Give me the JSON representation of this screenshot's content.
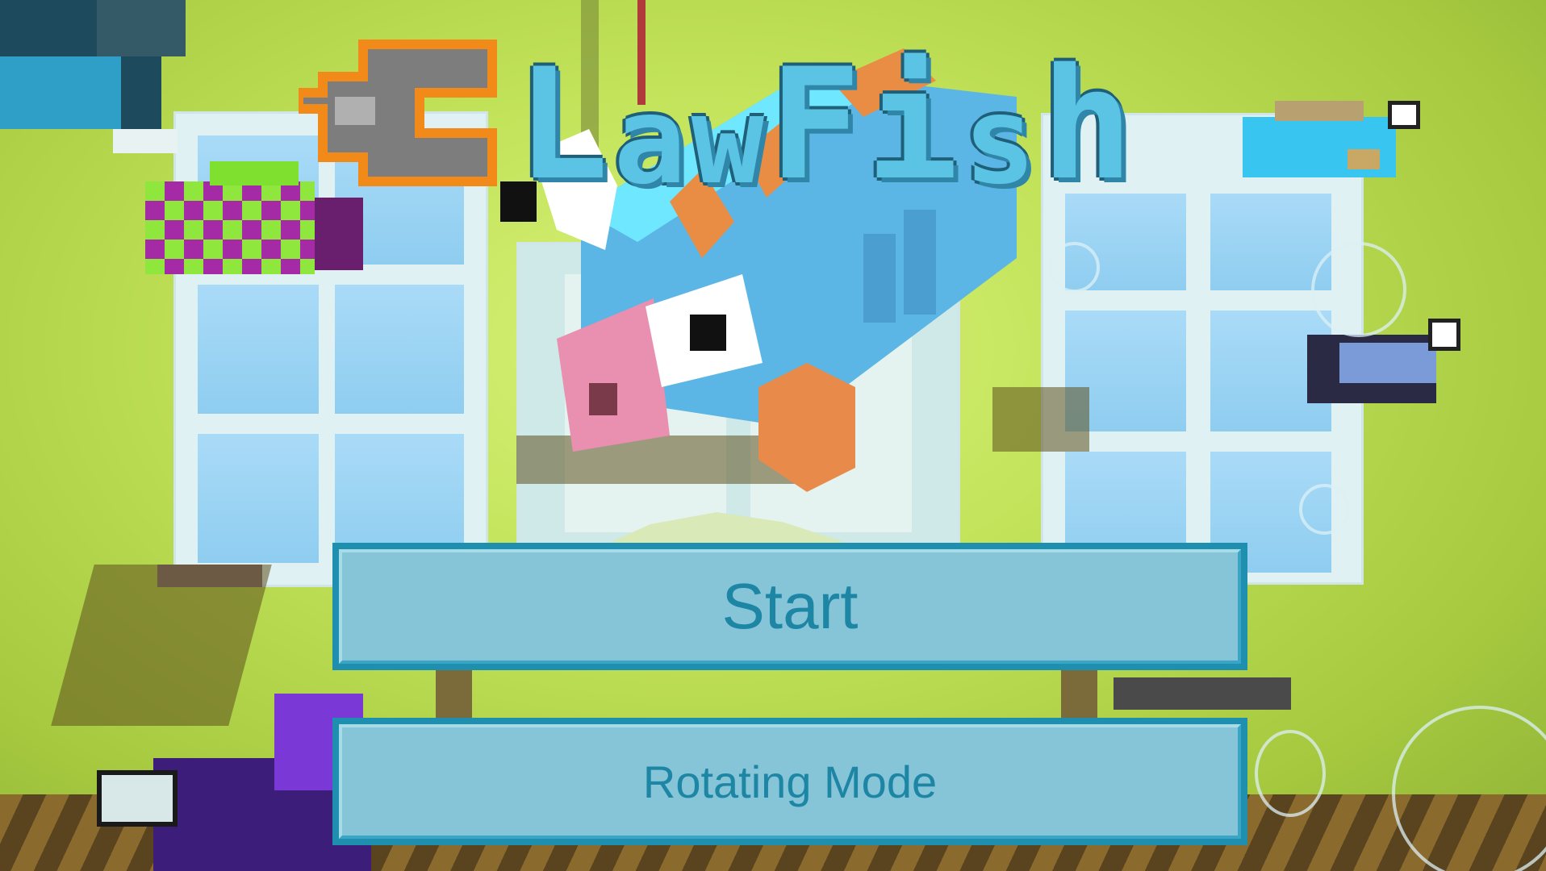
{
  "game": {
    "title_letters": [
      "C",
      "L",
      "a",
      "w",
      "F",
      "i",
      "s",
      "h"
    ],
    "title_text": "ClawFish"
  },
  "menu": {
    "start_label": "Start",
    "rotating_mode_label": "Rotating Mode"
  },
  "colors": {
    "background": "#c2e35a",
    "button_border": "#1f8fb0",
    "button_fill": "#86c4d7",
    "button_text": "#1e86a5",
    "title_fill": "#5bc4e4",
    "claw_outline": "#f28a1a",
    "claw_gray": "#7d7d7d"
  },
  "icons": {
    "claw": "claw-icon",
    "main_fish": "blue-fish",
    "small_fish": "pixel-fish"
  }
}
